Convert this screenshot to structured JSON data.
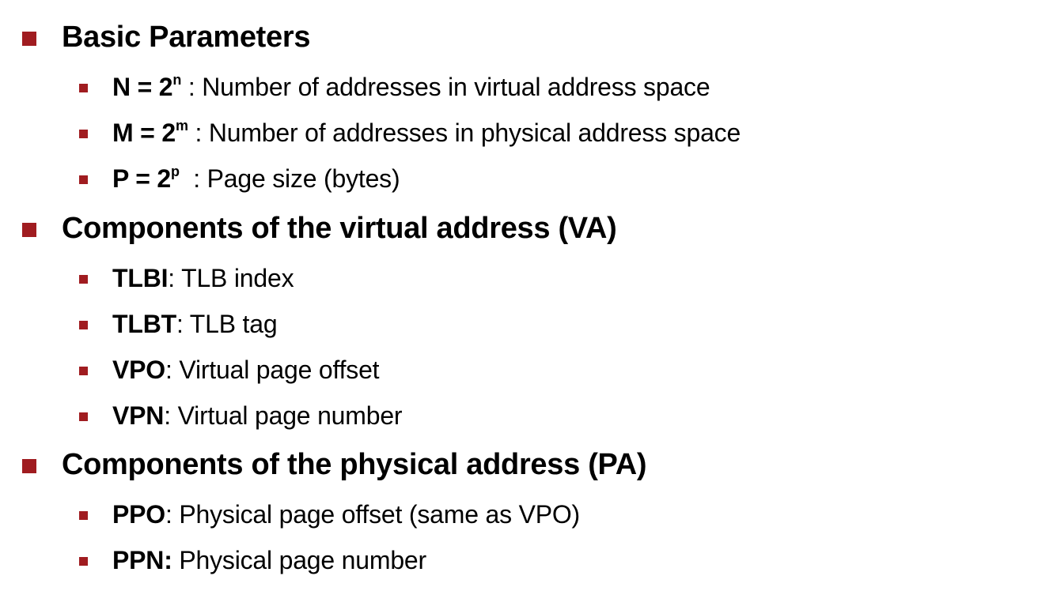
{
  "bullet_color": "#a01c20",
  "sections": [
    {
      "heading": "Basic Parameters",
      "items": [
        {
          "term": "N = 2",
          "sup": "n",
          "sep": " : ",
          "desc": "Number of addresses in virtual address space"
        },
        {
          "term": "M = 2",
          "sup": "m",
          "sep": " : ",
          "desc": "Number of addresses in physical address space"
        },
        {
          "term": "P = 2",
          "sup": "p",
          "sep": "  : ",
          "desc": "Page size (bytes)"
        }
      ]
    },
    {
      "heading": "Components of the virtual address (VA)",
      "items": [
        {
          "term": "TLBI",
          "sep": ": ",
          "desc": "TLB index"
        },
        {
          "term": "TLBT",
          "sep": ": ",
          "desc": "TLB tag"
        },
        {
          "term": "VPO",
          "sep": ": ",
          "desc": "Virtual page offset"
        },
        {
          "term": "VPN",
          "sep": ": ",
          "desc": "Virtual page number"
        }
      ]
    },
    {
      "heading": "Components of the physical address (PA)",
      "items": [
        {
          "term": "PPO",
          "sep": ": ",
          "desc": "Physical page offset (same as VPO)"
        },
        {
          "term": "PPN:",
          "sep": " ",
          "desc": "Physical page number"
        }
      ]
    }
  ]
}
